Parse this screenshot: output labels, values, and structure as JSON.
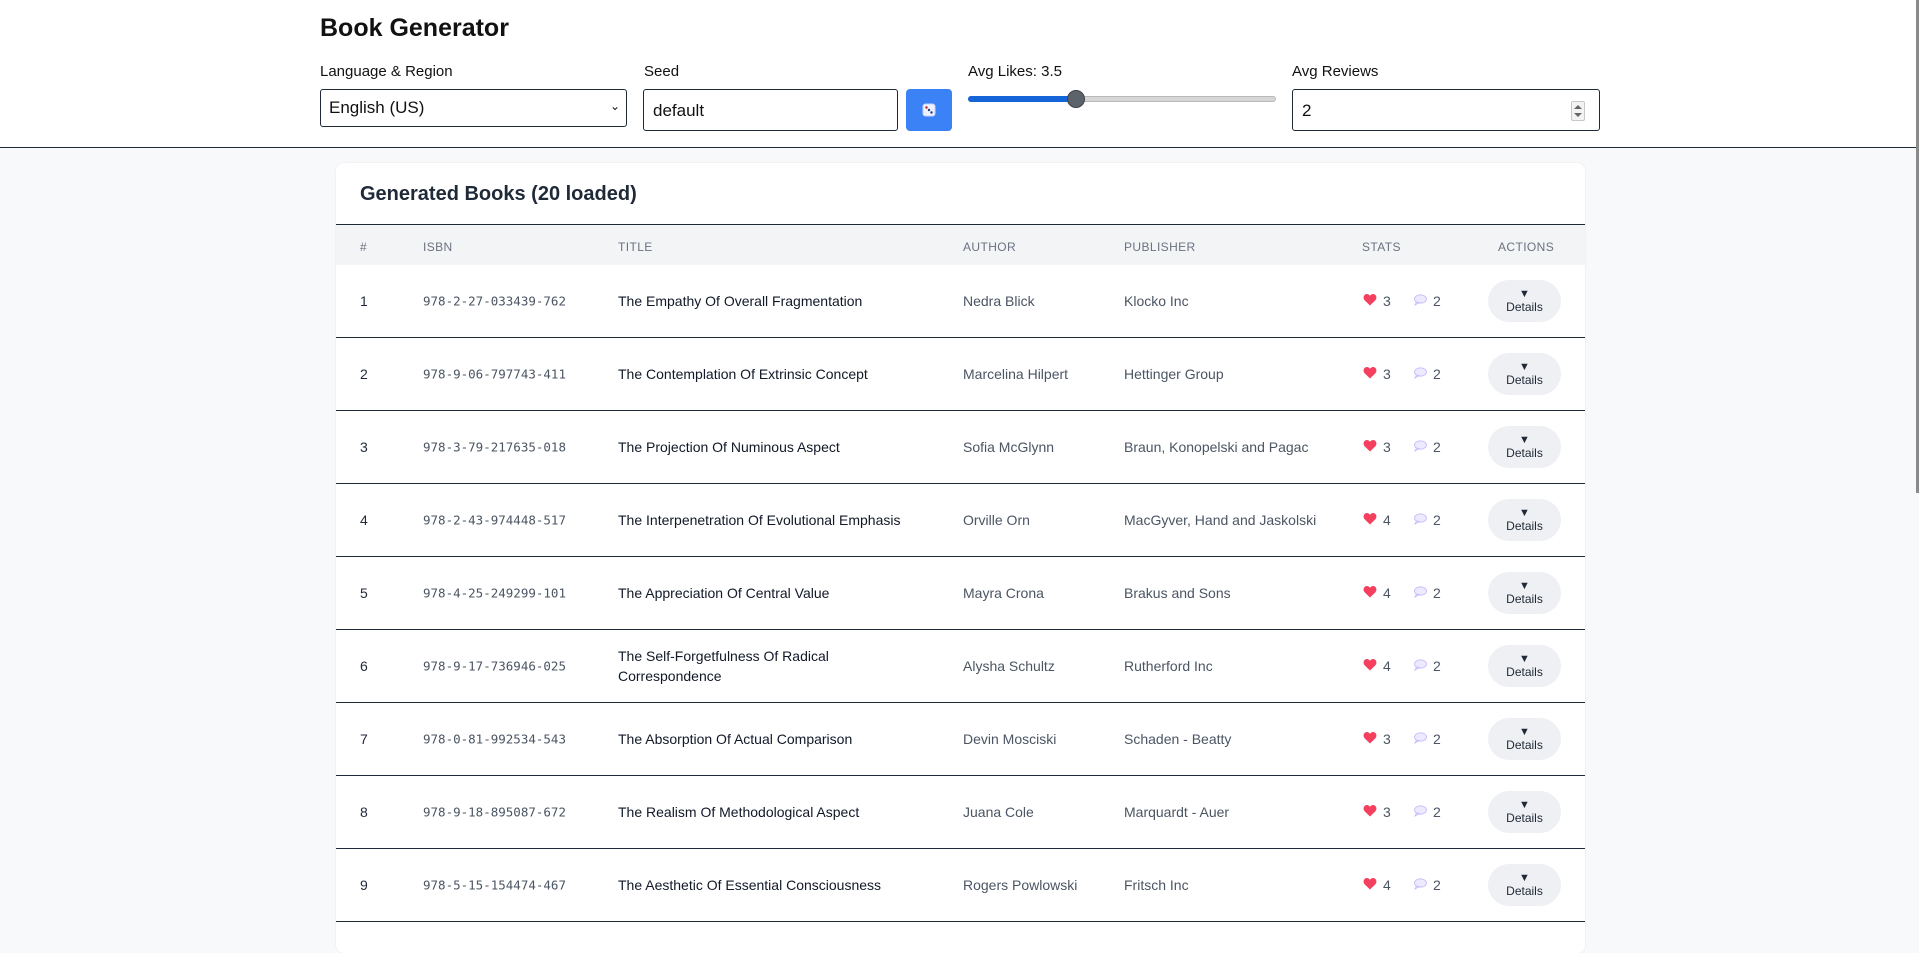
{
  "app": {
    "title": "Book Generator"
  },
  "controls": {
    "language_label": "Language & Region",
    "language_value": "English (US)",
    "seed_label": "Seed",
    "seed_value": "default",
    "likes_label": "Avg Likes: 3.5",
    "likes_value": 3.5,
    "likes_fraction": 0.35,
    "reviews_label": "Avg Reviews",
    "reviews_value": "2"
  },
  "table": {
    "title": "Generated Books (20 loaded)",
    "headers": [
      "#",
      "ISBN",
      "TITLE",
      "AUTHOR",
      "PUBLISHER",
      "STATS",
      "ACTIONS"
    ],
    "details_label": "Details",
    "rows": [
      {
        "num": "1",
        "isbn": "978-2-27-033439-762",
        "title": "The Empathy Of Overall Fragmentation",
        "author": "Nedra Blick",
        "publisher": "Klocko Inc",
        "likes": "3",
        "reviews": "2"
      },
      {
        "num": "2",
        "isbn": "978-9-06-797743-411",
        "title": "The Contemplation Of Extrinsic Concept",
        "author": "Marcelina Hilpert",
        "publisher": "Hettinger Group",
        "likes": "3",
        "reviews": "2"
      },
      {
        "num": "3",
        "isbn": "978-3-79-217635-018",
        "title": "The Projection Of Numinous Aspect",
        "author": "Sofia McGlynn",
        "publisher": "Braun, Konopelski and Pagac",
        "likes": "3",
        "reviews": "2"
      },
      {
        "num": "4",
        "isbn": "978-2-43-974448-517",
        "title": "The Interpenetration Of Evolutional Emphasis",
        "author": "Orville Orn",
        "publisher": "MacGyver, Hand and Jaskolski",
        "likes": "4",
        "reviews": "2"
      },
      {
        "num": "5",
        "isbn": "978-4-25-249299-101",
        "title": "The Appreciation Of Central Value",
        "author": "Mayra Crona",
        "publisher": "Brakus and Sons",
        "likes": "4",
        "reviews": "2"
      },
      {
        "num": "6",
        "isbn": "978-9-17-736946-025",
        "title": "The Self-Forgetfulness Of Radical Correspondence",
        "author": "Alysha Schultz",
        "publisher": "Rutherford Inc",
        "likes": "4",
        "reviews": "2"
      },
      {
        "num": "7",
        "isbn": "978-0-81-992534-543",
        "title": "The Absorption Of Actual Comparison",
        "author": "Devin Mosciski",
        "publisher": "Schaden - Beatty",
        "likes": "3",
        "reviews": "2"
      },
      {
        "num": "8",
        "isbn": "978-9-18-895087-672",
        "title": "The Realism Of Methodological Aspect",
        "author": "Juana Cole",
        "publisher": "Marquardt - Auer",
        "likes": "3",
        "reviews": "2"
      },
      {
        "num": "9",
        "isbn": "978-5-15-154474-467",
        "title": "The Aesthetic Of Essential Consciousness",
        "author": "Rogers Powlowski",
        "publisher": "Fritsch Inc",
        "likes": "4",
        "reviews": "2"
      }
    ]
  },
  "icons": {
    "likes": "heart-icon",
    "reviews": "comment-icon",
    "randomize": "dice-icon",
    "expand": "triangle-down-icon"
  },
  "colors": {
    "accent": "#3b82f6",
    "slider": "#1565d8",
    "heart": "#f43f5e"
  }
}
